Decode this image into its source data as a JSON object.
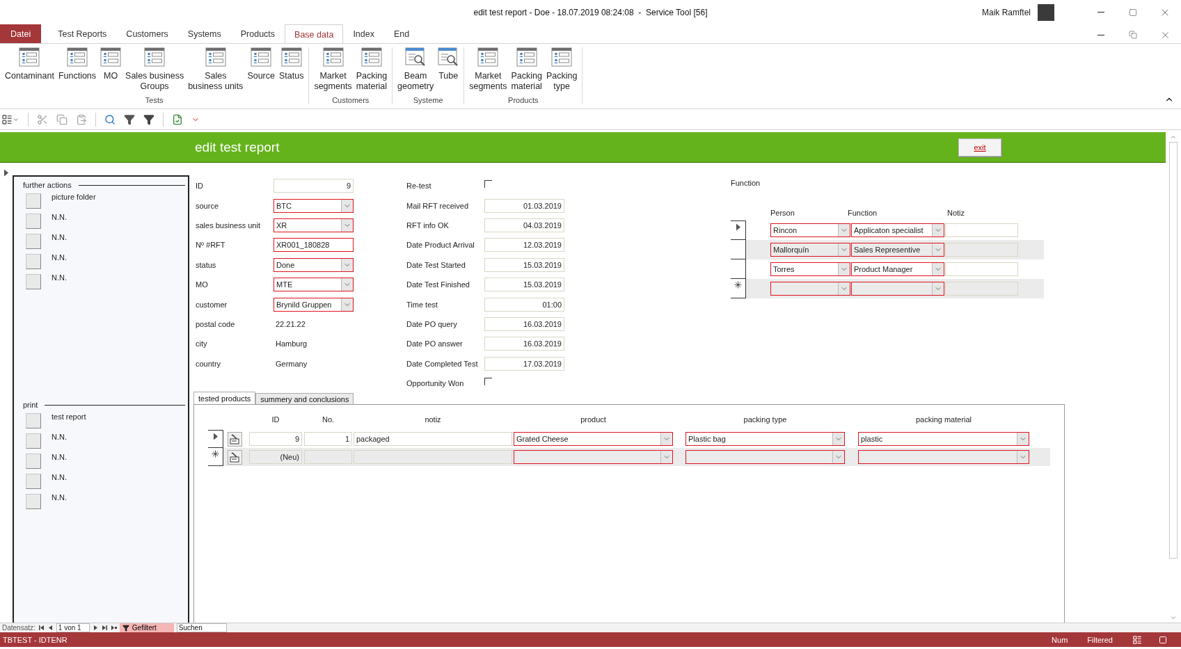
{
  "window": {
    "title": "edit test report - Doe - 18.07.2019 08:24:08  -  Service Tool [56]",
    "user": "Maik Ramftel"
  },
  "ribbon_tabs": [
    {
      "label": "Datei",
      "kind": "file",
      "selected": false
    },
    {
      "label": "Test Reports",
      "kind": "tab",
      "selected": false
    },
    {
      "label": "Customers",
      "kind": "tab",
      "selected": false
    },
    {
      "label": "Systems",
      "kind": "tab",
      "selected": false
    },
    {
      "label": "Products",
      "kind": "tab",
      "selected": false
    },
    {
      "label": "Base data",
      "kind": "tab",
      "selected": true
    },
    {
      "label": "Index",
      "kind": "tab",
      "selected": false
    },
    {
      "label": "End",
      "kind": "tab",
      "selected": false
    }
  ],
  "ribbon_groups": [
    {
      "label": "Tests",
      "buttons": [
        {
          "label": "Contaminant",
          "kind": "form"
        },
        {
          "label": "Functions",
          "kind": "form"
        },
        {
          "label": "MO",
          "kind": "form"
        },
        {
          "label": "Sales business\nGroups",
          "kind": "form"
        },
        {
          "label": "Sales\nbusiness units",
          "kind": "form"
        },
        {
          "label": "Source",
          "kind": "form"
        },
        {
          "label": "Status",
          "kind": "form"
        }
      ]
    },
    {
      "label": "Customers",
      "buttons": [
        {
          "label": "Market\nsegments",
          "kind": "form"
        },
        {
          "label": "Packing\nmaterial",
          "kind": "form"
        }
      ]
    },
    {
      "label": "Systeme",
      "buttons": [
        {
          "label": "Beam\ngeometry",
          "kind": "search"
        },
        {
          "label": "Tube",
          "kind": "search"
        }
      ]
    },
    {
      "label": "Products",
      "buttons": [
        {
          "label": "Market\nsegments",
          "kind": "form"
        },
        {
          "label": "Packing\nmaterial",
          "kind": "form"
        },
        {
          "label": "Packing\ntype",
          "kind": "form"
        }
      ]
    }
  ],
  "header": {
    "title": "edit test report",
    "exit_button": "exit"
  },
  "side_panel": [
    {
      "title": "further actions",
      "items": [
        "picture folder",
        "N.N.",
        "N.N.",
        "N.N.",
        "N.N."
      ]
    },
    {
      "title": "print",
      "items": [
        "test report",
        "N.N.",
        "N.N.",
        "N.N.",
        "N.N."
      ]
    }
  ],
  "form_left": [
    {
      "label": "ID",
      "kind": "number",
      "value": "9"
    },
    {
      "label": "source",
      "kind": "combo",
      "value": "BTC"
    },
    {
      "label": "sales business unit",
      "kind": "combo",
      "value": "XR"
    },
    {
      "label": "Nº #RFT",
      "kind": "text",
      "value": "XR001_180828"
    },
    {
      "label": "status",
      "kind": "combo",
      "value": "Done"
    },
    {
      "label": "MO",
      "kind": "combo",
      "value": "MTE"
    },
    {
      "label": "customer",
      "kind": "combo",
      "value": "Brynild Gruppen"
    },
    {
      "label": "postal code",
      "kind": "plain",
      "value": "22.21.22"
    },
    {
      "label": "city",
      "kind": "plain",
      "value": "Hamburg"
    },
    {
      "label": "country",
      "kind": "plain",
      "value": "Germany"
    }
  ],
  "form_right": [
    {
      "label": "Re-test",
      "kind": "checkbox",
      "checked": false
    },
    {
      "label": "Mail RFT received",
      "kind": "date",
      "value": "01.03.2019"
    },
    {
      "label": "RFT info OK",
      "kind": "date",
      "value": "04.03.2019"
    },
    {
      "label": "Date Product Arrival",
      "kind": "date",
      "value": "12.03.2019"
    },
    {
      "label": "Date Test Started",
      "kind": "date",
      "value": "15.03.2019"
    },
    {
      "label": "Date Test Finished",
      "kind": "date",
      "value": "15.03.2019"
    },
    {
      "label": "Time test",
      "kind": "date",
      "value": "01:00"
    },
    {
      "label": "Date PO query",
      "kind": "date",
      "value": "16.03.2019"
    },
    {
      "label": "Date PO answer",
      "kind": "date",
      "value": "16.03.2019"
    },
    {
      "label": "Date Completed Test",
      "kind": "date",
      "value": "17.03.2019"
    },
    {
      "label": "Opportunity Won",
      "kind": "checkbox",
      "checked": false
    }
  ],
  "function_panel": {
    "title": "Function",
    "columns": [
      "Person",
      "Function",
      "Notiz"
    ],
    "rows": [
      {
        "kind": "current",
        "person": "Rincon",
        "function": "Applicaton specialist"
      },
      {
        "kind": "record",
        "person": "Mallorquín",
        "function": "Sales Representive"
      },
      {
        "kind": "record",
        "person": "Torres",
        "function": "Product Manager"
      },
      {
        "kind": "new"
      }
    ]
  },
  "subform": {
    "tabs": [
      {
        "label": "tested products",
        "selected": true
      },
      {
        "label": "summery and conclusions",
        "selected": false
      }
    ],
    "columns": [
      "ID",
      "No.",
      "notiz",
      "product",
      "packing type",
      "packing material"
    ],
    "rows": [
      {
        "kind": "current",
        "id": "9",
        "no": "1",
        "notiz": "packaged",
        "product": "Grated Cheese",
        "packing_type": "Plastic bag",
        "packing_material": "plastic"
      },
      {
        "kind": "new",
        "id": "(Neu)"
      }
    ]
  },
  "record_nav": {
    "label": "Datensatz:",
    "position": "1 von 1",
    "filter": "Gefiltert",
    "search_placeholder": "Suchen"
  },
  "status_bar": {
    "left": "TBTEST - IDTENR",
    "items": [
      "Num",
      "Filtered"
    ]
  }
}
